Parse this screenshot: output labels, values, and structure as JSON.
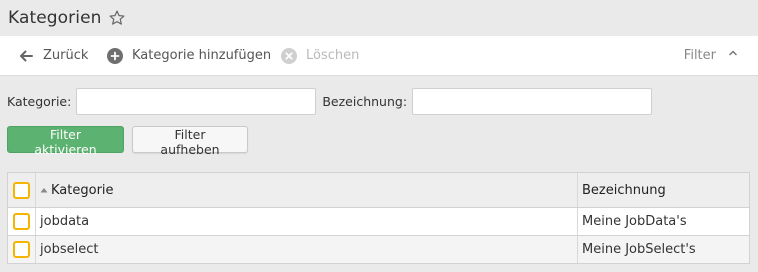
{
  "header": {
    "title": "Kategorien"
  },
  "toolbar": {
    "back_label": "Zurück",
    "add_label": "Kategorie hinzufügen",
    "delete_label": "Löschen",
    "filter_label": "Filter"
  },
  "filters": {
    "category_label": "Kategorie:",
    "category_value": "",
    "description_label": "Bezeichnung:",
    "description_value": "",
    "apply_label": "Filter aktivieren",
    "clear_label": "Filter aufheben"
  },
  "table": {
    "columns": [
      "Kategorie",
      "Bezeichnung"
    ],
    "rows": [
      {
        "kategorie": "jobdata",
        "bezeichnung": "Meine JobData's"
      },
      {
        "kategorie": "jobselect",
        "bezeichnung": "Meine JobSelect's"
      }
    ]
  },
  "colors": {
    "accent_green": "#5cb270",
    "checkbox_border": "#f4b400",
    "disabled_text": "#b9b9b9"
  }
}
